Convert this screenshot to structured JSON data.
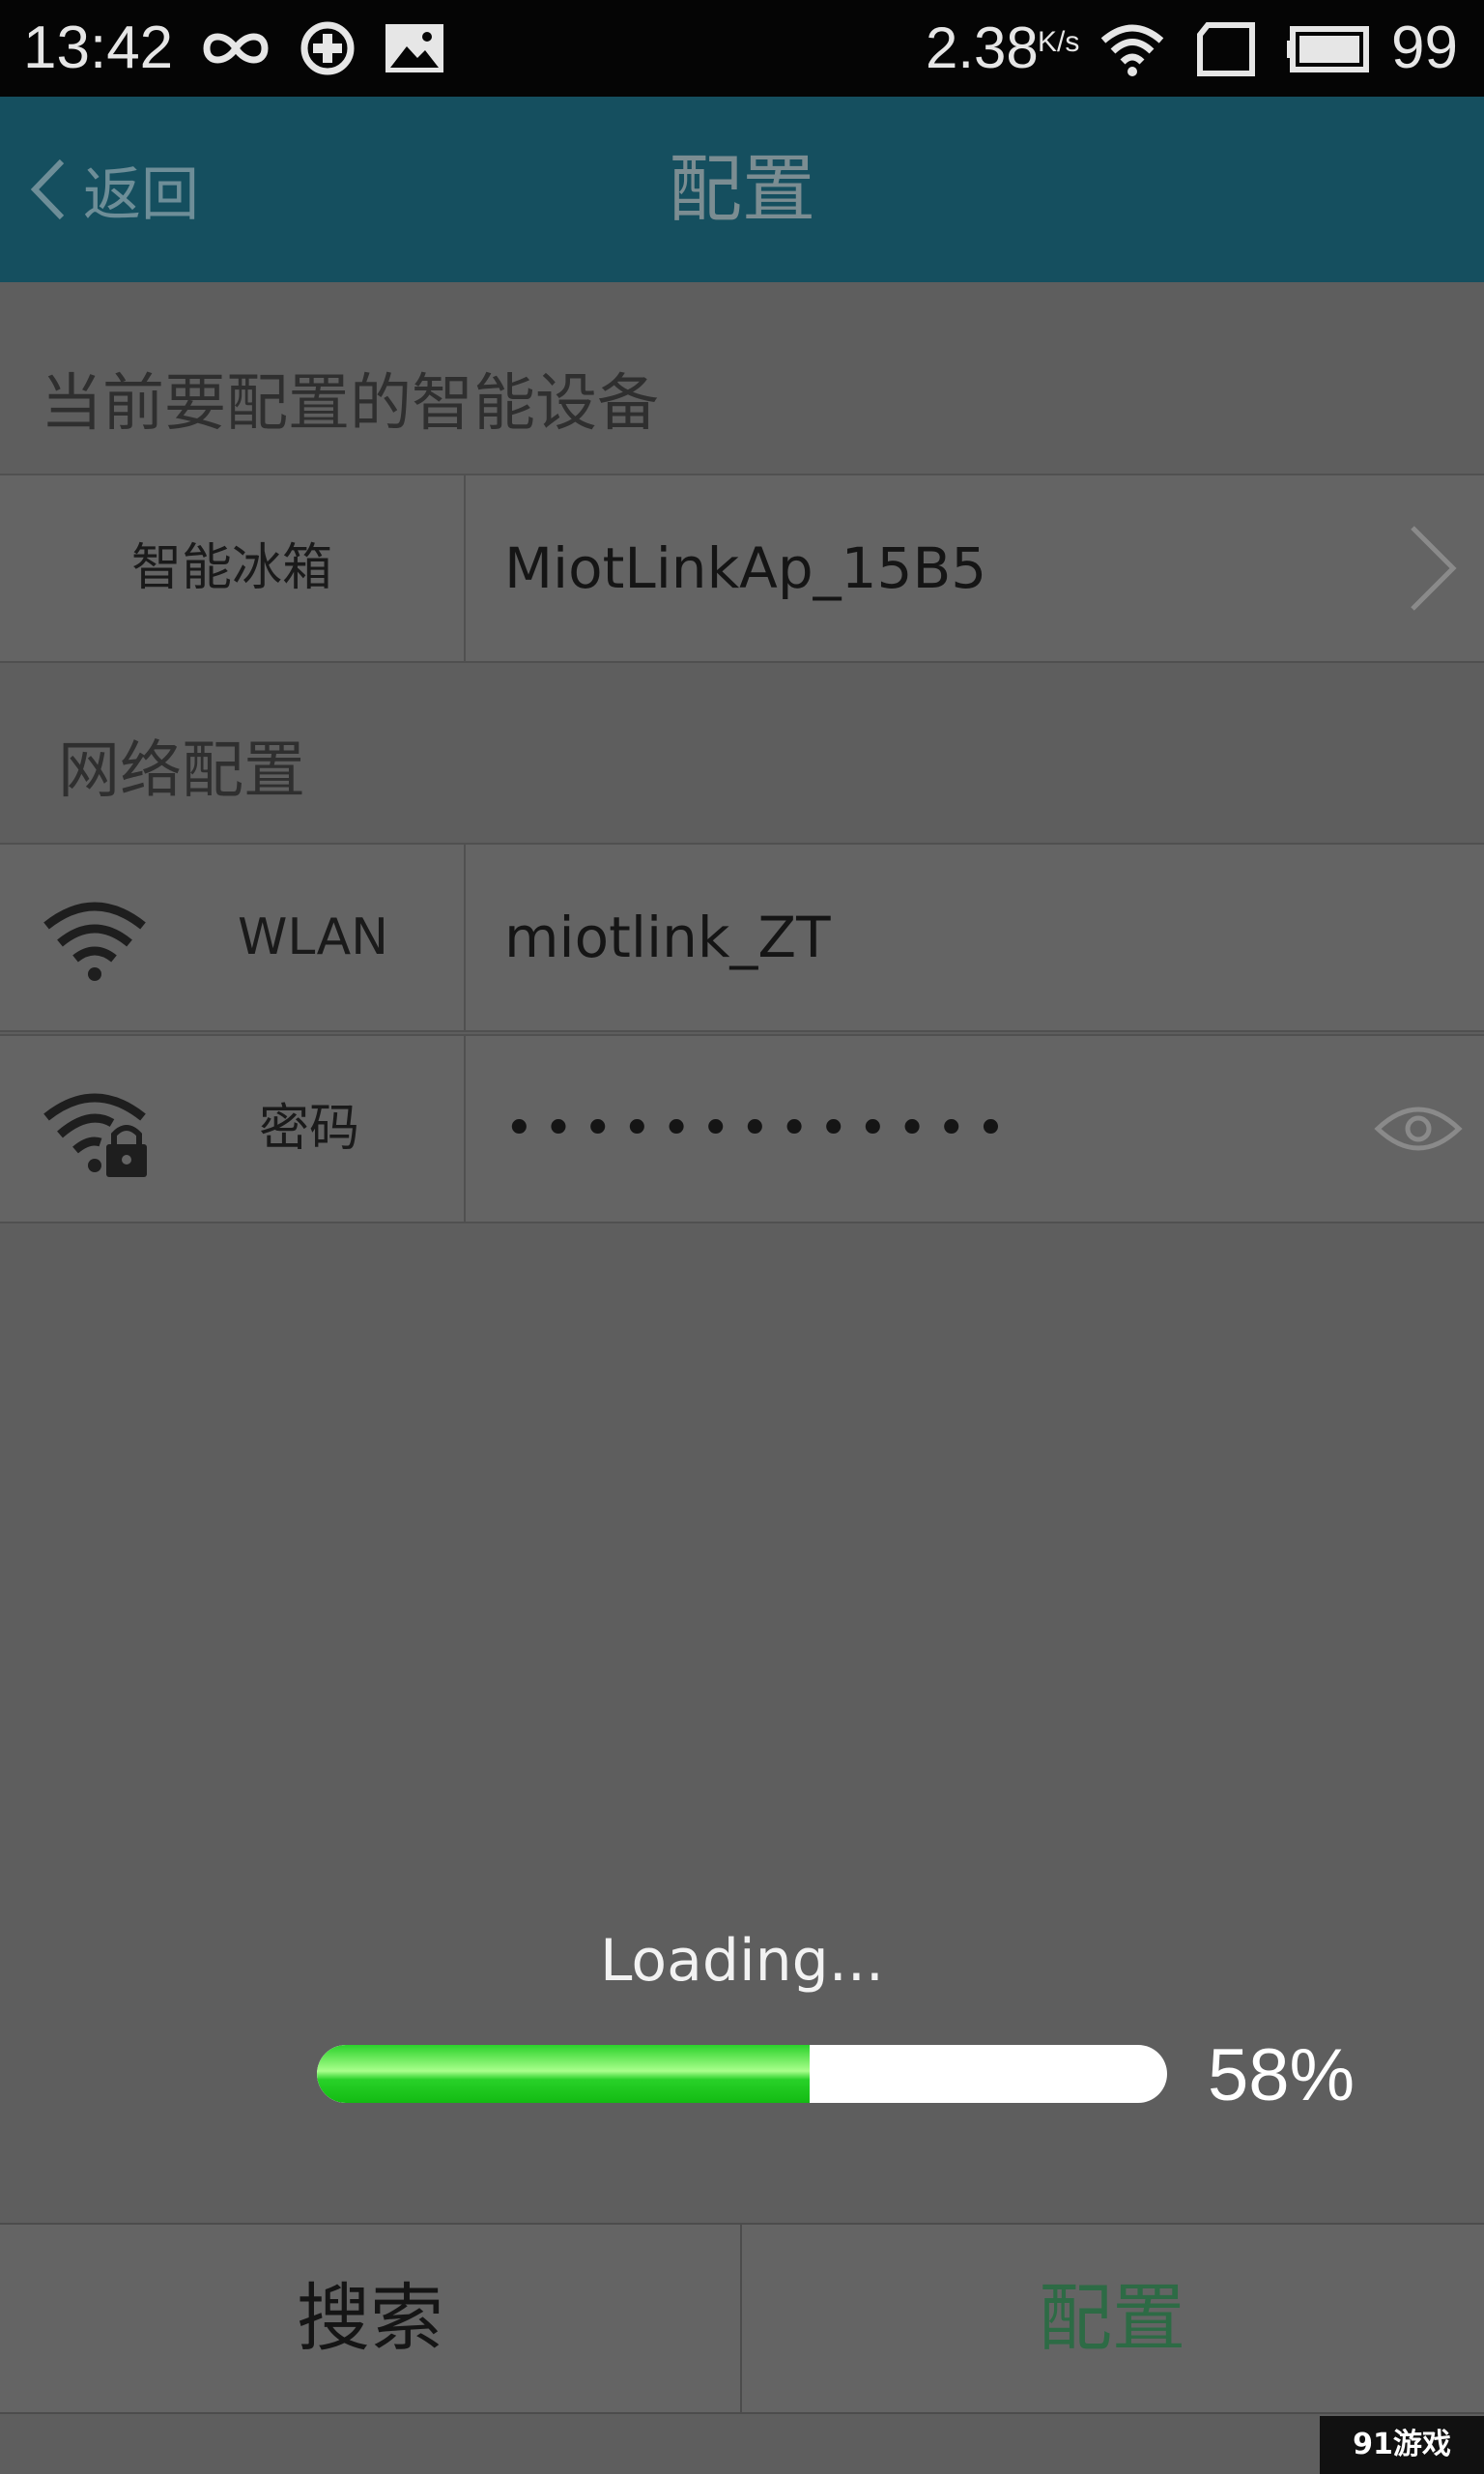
{
  "status_bar": {
    "time": "13:42",
    "network_speed": "2.38",
    "network_speed_unit": "K/s",
    "battery_level": "99",
    "icons": [
      "infinity-icon",
      "sync-icon",
      "image-icon",
      "wifi-icon",
      "sim-card-icon",
      "battery-icon"
    ]
  },
  "header": {
    "back_label": "返回",
    "title": "配置",
    "background_color": "#154f5f"
  },
  "device_section": {
    "title": "当前要配置的智能设备",
    "device_type": "智能冰箱",
    "device_ap": "MiotLinkAp_15B5"
  },
  "network_section": {
    "title": "网络配置",
    "wlan_label": "WLAN",
    "wlan_value": "miotlink_ZT",
    "password_label": "密码",
    "password_value": "•••••••••••••"
  },
  "loading": {
    "text": "Loading...",
    "progress_percent": 58,
    "progress_label": "58%"
  },
  "bottom_bar": {
    "search_label": "搜索",
    "config_label": "配置",
    "config_color": "#2d6b45"
  },
  "watermark": {
    "text": "91游戏"
  }
}
